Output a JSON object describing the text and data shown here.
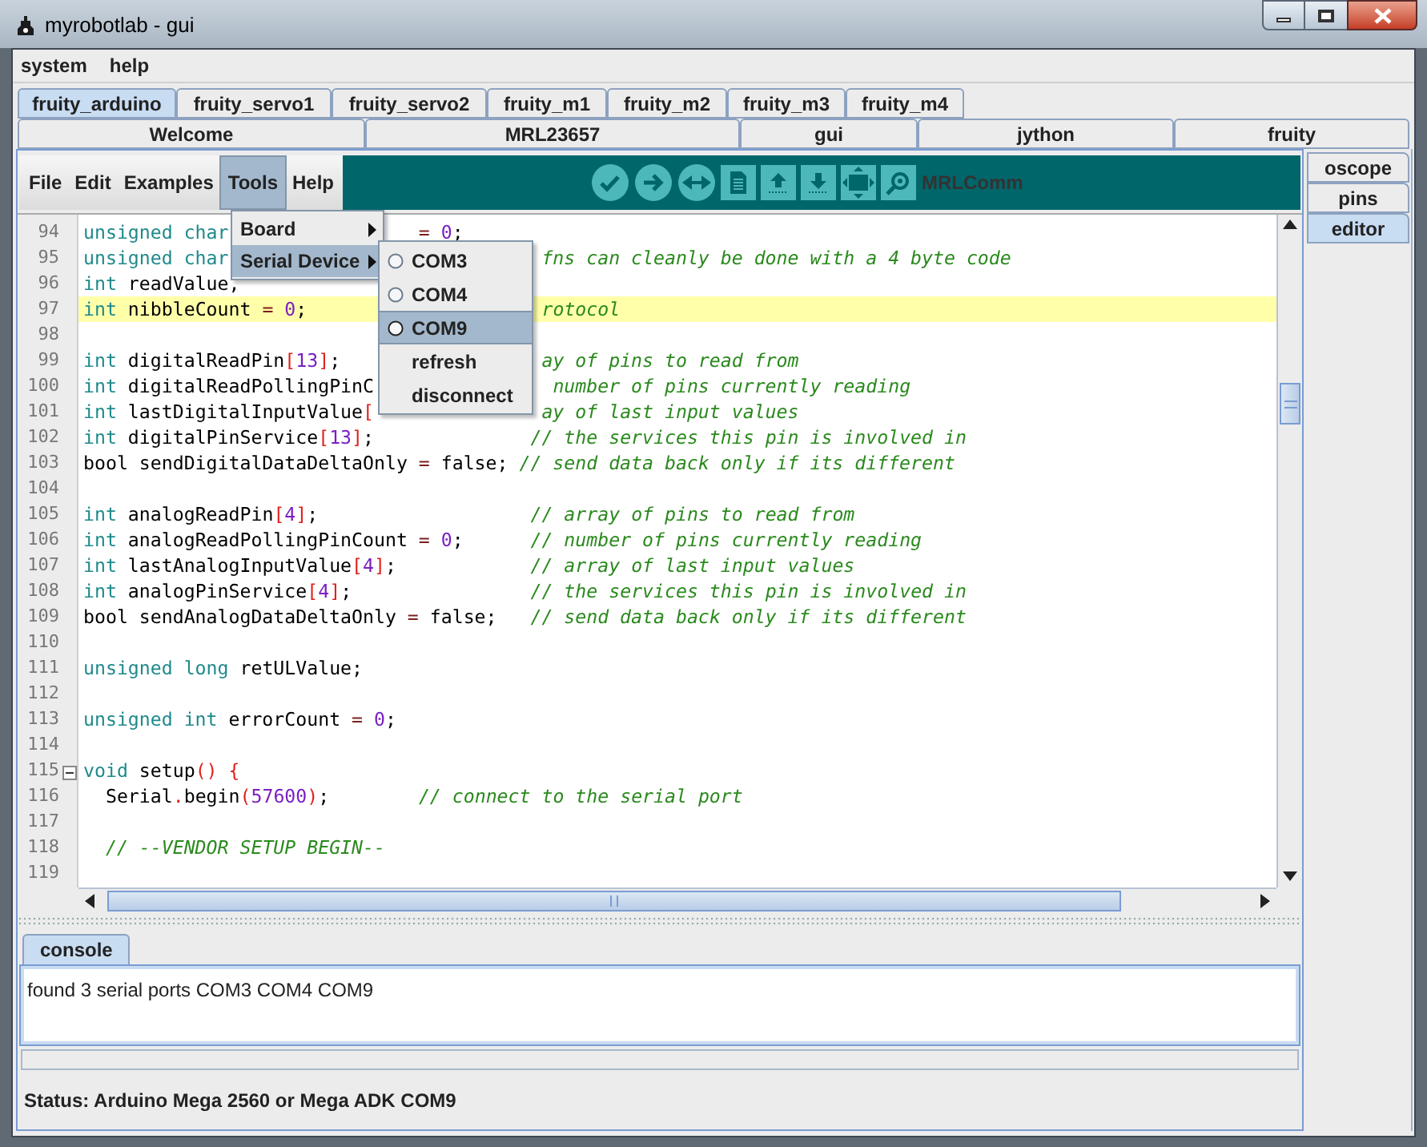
{
  "window": {
    "title": "myrobotlab - gui"
  },
  "menu_bar": [
    "system",
    "help"
  ],
  "service_tabs": [
    {
      "label": "fruity_arduino",
      "selected": true
    },
    {
      "label": "fruity_servo1",
      "selected": false
    },
    {
      "label": "fruity_servo2",
      "selected": false
    },
    {
      "label": "fruity_m1",
      "selected": false
    },
    {
      "label": "fruity_m2",
      "selected": false
    },
    {
      "label": "fruity_m3",
      "selected": false
    },
    {
      "label": "fruity_m4",
      "selected": false
    }
  ],
  "service_tabs_row2": [
    {
      "label": "Welcome",
      "selected": false
    },
    {
      "label": "MRL23657",
      "selected": false
    },
    {
      "label": "gui",
      "selected": false
    },
    {
      "label": "jython",
      "selected": false
    },
    {
      "label": "fruity",
      "selected": false
    }
  ],
  "side_tabs": [
    {
      "label": "oscope",
      "selected": false
    },
    {
      "label": "pins",
      "selected": false
    },
    {
      "label": "editor",
      "selected": true
    }
  ],
  "editor_menu": [
    {
      "label": "File",
      "selected": false
    },
    {
      "label": "Edit",
      "selected": false
    },
    {
      "label": "Examples",
      "selected": false
    },
    {
      "label": "Tools",
      "selected": true
    },
    {
      "label": "Help",
      "selected": false
    }
  ],
  "toolbar": {
    "buttons": [
      {
        "kind": "verify"
      },
      {
        "kind": "upload"
      },
      {
        "kind": "connect"
      },
      {
        "kind": "new"
      },
      {
        "kind": "open"
      },
      {
        "kind": "save"
      },
      {
        "kind": "serial"
      },
      {
        "kind": "monitor"
      }
    ],
    "sketch_name": "MRLComm"
  },
  "tools_menu": [
    {
      "label": "Board",
      "selected": false
    },
    {
      "label": "Serial Device",
      "selected": true
    }
  ],
  "serial_menu": [
    {
      "label": "COM3",
      "kind": "radio",
      "checked": false,
      "selected": false
    },
    {
      "label": "COM4",
      "kind": "radio",
      "checked": false,
      "selected": false
    },
    {
      "label": "COM9",
      "kind": "radio",
      "checked": false,
      "selected": true
    },
    {
      "label": "refresh",
      "kind": "action",
      "selected": false
    },
    {
      "label": "disconnect",
      "kind": "action",
      "selected": false
    }
  ],
  "code_lines": [
    {
      "number": "94",
      "highlighted": false,
      "foldable": false,
      "tokens": [
        {
          "kind": "keyword",
          "text": "unsigned char"
        }
      ],
      "tokens_after_menu": [
        {
          "kind": "operator",
          "text": "                 ="
        },
        {
          "kind": "number",
          "text": " 0"
        },
        {
          "kind": "plain",
          "text": ";"
        }
      ]
    },
    {
      "number": "95",
      "highlighted": false,
      "foldable": false,
      "tokens": [
        {
          "kind": "keyword",
          "text": "unsigned char"
        }
      ],
      "tokens_after_menu": [
        {
          "kind": "comment",
          "text": "                            fns can cleanly be done with a 4 byte code"
        }
      ]
    },
    {
      "number": "96",
      "highlighted": false,
      "foldable": false,
      "tokens": [
        {
          "kind": "keyword",
          "text": "int"
        },
        {
          "kind": "plain",
          "text": " readValue,"
        }
      ]
    },
    {
      "number": "97",
      "highlighted": true,
      "foldable": false,
      "tokens": [
        {
          "kind": "keyword",
          "text": "int"
        },
        {
          "kind": "plain",
          "text": " nibbleCount "
        },
        {
          "kind": "operator",
          "text": "="
        },
        {
          "kind": "number",
          "text": " 0"
        },
        {
          "kind": "plain",
          "text": ";"
        }
      ],
      "tokens_after_menu": [
        {
          "kind": "comment",
          "text": "                     rotocol"
        }
      ]
    },
    {
      "number": "98",
      "highlighted": false,
      "foldable": false
    },
    {
      "number": "99",
      "highlighted": false,
      "foldable": false,
      "tokens": [
        {
          "kind": "keyword",
          "text": "int"
        },
        {
          "kind": "plain",
          "text": " digitalReadPin"
        },
        {
          "kind": "bracket",
          "text": "["
        },
        {
          "kind": "number",
          "text": "13"
        },
        {
          "kind": "bracket",
          "text": "]"
        },
        {
          "kind": "plain",
          "text": ";"
        }
      ],
      "tokens_after_menu": [
        {
          "kind": "comment",
          "text": "                  ay of pins to read from"
        }
      ]
    },
    {
      "number": "100",
      "highlighted": false,
      "foldable": false,
      "tokens": [
        {
          "kind": "keyword",
          "text": "int"
        },
        {
          "kind": "plain",
          "text": " digitalReadPollingPinC"
        }
      ],
      "tokens_after_menu": [
        {
          "kind": "comment",
          "text": "                number of pins currently reading"
        }
      ]
    },
    {
      "number": "101",
      "highlighted": false,
      "foldable": false,
      "tokens": [
        {
          "kind": "keyword",
          "text": "int"
        },
        {
          "kind": "plain",
          "text": " lastDigitalInputValue"
        },
        {
          "kind": "bracket",
          "text": "["
        }
      ],
      "tokens_after_menu": [
        {
          "kind": "comment",
          "text": "               ay of last input values"
        }
      ]
    },
    {
      "number": "102",
      "highlighted": false,
      "foldable": false,
      "tokens": [
        {
          "kind": "keyword",
          "text": "int"
        },
        {
          "kind": "plain",
          "text": " digitalPinService"
        },
        {
          "kind": "bracket",
          "text": "["
        },
        {
          "kind": "number",
          "text": "13"
        },
        {
          "kind": "bracket",
          "text": "]"
        },
        {
          "kind": "plain",
          "text": ";"
        },
        {
          "kind": "comment",
          "text": "              // the services this pin is involved in"
        }
      ]
    },
    {
      "number": "103",
      "highlighted": false,
      "foldable": false,
      "tokens": [
        {
          "kind": "plain",
          "text": "bool sendDigitalDataDeltaOnly "
        },
        {
          "kind": "operator",
          "text": "="
        },
        {
          "kind": "plain",
          "text": " false; "
        },
        {
          "kind": "comment",
          "text": "// send data back only if its different"
        }
      ]
    },
    {
      "number": "104",
      "highlighted": false,
      "foldable": false
    },
    {
      "number": "105",
      "highlighted": false,
      "foldable": false,
      "tokens": [
        {
          "kind": "keyword",
          "text": "int"
        },
        {
          "kind": "plain",
          "text": " analogReadPin"
        },
        {
          "kind": "bracket",
          "text": "["
        },
        {
          "kind": "number",
          "text": "4"
        },
        {
          "kind": "bracket",
          "text": "]"
        },
        {
          "kind": "plain",
          "text": ";"
        },
        {
          "kind": "comment",
          "text": "                   // array of pins to read from"
        }
      ]
    },
    {
      "number": "106",
      "highlighted": false,
      "foldable": false,
      "tokens": [
        {
          "kind": "keyword",
          "text": "int"
        },
        {
          "kind": "plain",
          "text": " analogReadPollingPinCount "
        },
        {
          "kind": "operator",
          "text": "="
        },
        {
          "kind": "number",
          "text": " 0"
        },
        {
          "kind": "plain",
          "text": ";"
        },
        {
          "kind": "comment",
          "text": "      // number of pins currently reading"
        }
      ]
    },
    {
      "number": "107",
      "highlighted": false,
      "foldable": false,
      "tokens": [
        {
          "kind": "keyword",
          "text": "int"
        },
        {
          "kind": "plain",
          "text": " lastAnalogInputValue"
        },
        {
          "kind": "bracket",
          "text": "["
        },
        {
          "kind": "number",
          "text": "4"
        },
        {
          "kind": "bracket",
          "text": "]"
        },
        {
          "kind": "plain",
          "text": ";"
        },
        {
          "kind": "comment",
          "text": "            // array of last input values"
        }
      ]
    },
    {
      "number": "108",
      "highlighted": false,
      "foldable": false,
      "tokens": [
        {
          "kind": "keyword",
          "text": "int"
        },
        {
          "kind": "plain",
          "text": " analogPinService"
        },
        {
          "kind": "bracket",
          "text": "["
        },
        {
          "kind": "number",
          "text": "4"
        },
        {
          "kind": "bracket",
          "text": "]"
        },
        {
          "kind": "plain",
          "text": ";"
        },
        {
          "kind": "comment",
          "text": "                // the services this pin is involved in"
        }
      ]
    },
    {
      "number": "109",
      "highlighted": false,
      "foldable": false,
      "tokens": [
        {
          "kind": "plain",
          "text": "bool sendAnalogDataDeltaOnly "
        },
        {
          "kind": "operator",
          "text": "="
        },
        {
          "kind": "plain",
          "text": " false;"
        },
        {
          "kind": "comment",
          "text": "   // send data back only if its different"
        }
      ]
    },
    {
      "number": "110",
      "highlighted": false,
      "foldable": false
    },
    {
      "number": "111",
      "highlighted": false,
      "foldable": false,
      "tokens": [
        {
          "kind": "keyword",
          "text": "unsigned long"
        },
        {
          "kind": "plain",
          "text": " retULValue;"
        }
      ]
    },
    {
      "number": "112",
      "highlighted": false,
      "foldable": false
    },
    {
      "number": "113",
      "highlighted": false,
      "foldable": false,
      "tokens": [
        {
          "kind": "keyword",
          "text": "unsigned int"
        },
        {
          "kind": "plain",
          "text": " errorCount "
        },
        {
          "kind": "operator",
          "text": "="
        },
        {
          "kind": "number",
          "text": " 0"
        },
        {
          "kind": "plain",
          "text": ";"
        }
      ]
    },
    {
      "number": "114",
      "highlighted": false,
      "foldable": false
    },
    {
      "number": "115",
      "highlighted": false,
      "foldable": true,
      "tokens": [
        {
          "kind": "keyword",
          "text": "void"
        },
        {
          "kind": "plain",
          "text": " setup"
        },
        {
          "kind": "bracket",
          "text": "()"
        },
        {
          "kind": "bracket",
          "text": " {"
        }
      ]
    },
    {
      "number": "116",
      "highlighted": false,
      "foldable": false,
      "tokens": [
        {
          "kind": "plain",
          "text": "  Serial"
        },
        {
          "kind": "bracket",
          "text": "."
        },
        {
          "kind": "plain",
          "text": "begin"
        },
        {
          "kind": "bracket",
          "text": "("
        },
        {
          "kind": "number",
          "text": "57600"
        },
        {
          "kind": "bracket",
          "text": ")"
        },
        {
          "kind": "plain",
          "text": ";"
        },
        {
          "kind": "comment",
          "text": "        // connect to the serial port"
        }
      ]
    },
    {
      "number": "117",
      "highlighted": false,
      "foldable": false
    },
    {
      "number": "118",
      "highlighted": false,
      "foldable": false,
      "tokens": [
        {
          "kind": "comment",
          "text": "  // --VENDOR SETUP BEGIN--"
        }
      ]
    },
    {
      "number": "119",
      "highlighted": false,
      "foldable": false
    }
  ],
  "console": {
    "tab": "console",
    "text": "found 3 serial ports COM3 COM4 COM9"
  },
  "status": "Status: Arduino Mega 2560 or Mega ADK COM9"
}
